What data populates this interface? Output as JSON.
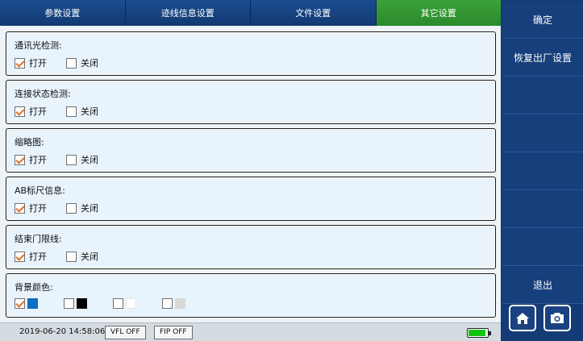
{
  "tabs": [
    {
      "label": "参数设置",
      "active": false
    },
    {
      "label": "迹线信息设置",
      "active": false
    },
    {
      "label": "文件设置",
      "active": false
    },
    {
      "label": "其它设置",
      "active": true
    }
  ],
  "sections": [
    {
      "title": "通讯光检测:",
      "options": [
        {
          "label": "打开",
          "checked": true
        },
        {
          "label": "关闭",
          "checked": false
        }
      ]
    },
    {
      "title": "连接状态检测:",
      "options": [
        {
          "label": "打开",
          "checked": true
        },
        {
          "label": "关闭",
          "checked": false
        }
      ]
    },
    {
      "title": "缩略图:",
      "options": [
        {
          "label": "打开",
          "checked": true
        },
        {
          "label": "关闭",
          "checked": false
        }
      ]
    },
    {
      "title": "AB标尺信息:",
      "options": [
        {
          "label": "打开",
          "checked": true
        },
        {
          "label": "关闭",
          "checked": false
        }
      ]
    },
    {
      "title": "结束门限线:",
      "options": [
        {
          "label": "打开",
          "checked": true
        },
        {
          "label": "关闭",
          "checked": false
        }
      ]
    }
  ],
  "background_color": {
    "title": "背景颜色:",
    "options": [
      {
        "color": "#0a6fc2",
        "checked": true
      },
      {
        "color": "#000000",
        "checked": false
      },
      {
        "color": "#ffffff",
        "checked": false
      },
      {
        "color": "#d8d8d8",
        "checked": false
      }
    ]
  },
  "status_bar": {
    "datetime": "2019-06-20 14:58:06",
    "vfl": "VFL OFF",
    "fip": "FIP OFF",
    "battery_level": 0.9
  },
  "sidebar": {
    "confirm": "确定",
    "restore": "恢复出厂设置",
    "exit": "退出",
    "home_icon": "home-icon",
    "camera_icon": "camera-icon"
  },
  "colors": {
    "tab_bg": "#123a72",
    "tab_active": "#2c8a2c",
    "sidebar_bg": "#153b76",
    "check_mark": "#e07020"
  }
}
